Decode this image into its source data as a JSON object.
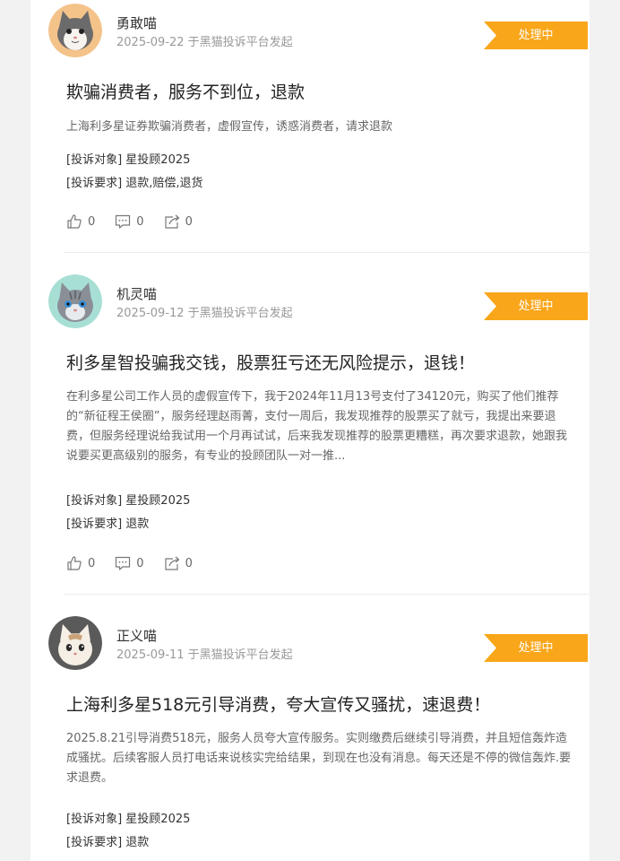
{
  "complaints": [
    {
      "user": "勇敢喵",
      "date": "2025-09-22",
      "source": "于黑猫投诉平台发起",
      "status": "处理中",
      "title": "欺骗消费者，服务不到位，退款",
      "description": "上海利多星证券欺骗消费者，虚假宣传，诱惑消费者，请求退款",
      "target_label": "[投诉对象]",
      "target": "星投顾2025",
      "demand_label": "[投诉要求]",
      "demand": "退款,赔偿,退货",
      "likes": "0",
      "comments": "0",
      "shares": "0"
    },
    {
      "user": "机灵喵",
      "date": "2025-09-12",
      "source": "于黑猫投诉平台发起",
      "status": "处理中",
      "title": "利多星智投骗我交钱，股票狂亏还无风险提示，退钱！",
      "description": "在利多星公司工作人员的虚假宣传下，我于2024年11月13号支付了34120元，购买了他们推荐的“新征程王侯圈”，服务经理赵雨菁，支付一周后，我发现推荐的股票买了就亏，我提出来要退费，但服务经理说给我试用一个月再试试，后来我发现推荐的股票更糟糕，再次要求退款，她跟我说要买更高级别的服务，有专业的投顾团队一对一推...",
      "target_label": "[投诉对象]",
      "target": "星投顾2025",
      "demand_label": "[投诉要求]",
      "demand": "退款",
      "likes": "0",
      "comments": "0",
      "shares": "0"
    },
    {
      "user": "正义喵",
      "date": "2025-09-11",
      "source": "于黑猫投诉平台发起",
      "status": "处理中",
      "title": "上海利多星518元引导消费，夸大宣传又骚扰，速退费！",
      "description": "2025.8.21引导消费518元，服务人员夸大宣传服务。实则缴费后继续引导消费，并且短信轰炸造成骚扰。后续客服人员打电话来说核实完给结果，到现在也没有消息。每天还是不停的微信轰炸.要求退费。",
      "target_label": "[投诉对象]",
      "target": "星投顾2025",
      "demand_label": "[投诉要求]",
      "demand": "退款"
    }
  ],
  "colors": {
    "status_bg": "#f9a61a",
    "title": "#222222",
    "meta": "#999999",
    "desc": "#666666"
  },
  "icons": [
    "like-icon",
    "comment-icon",
    "share-icon"
  ]
}
